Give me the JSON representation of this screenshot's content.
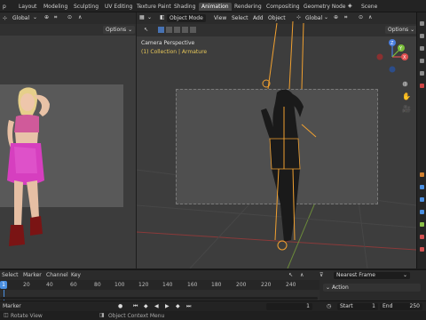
{
  "topbar": {
    "app_icon_text": "p",
    "tabs": [
      "Layout",
      "Modeling",
      "Sculpting",
      "UV Editing",
      "Texture Paint",
      "Shading",
      "Animation",
      "Rendering",
      "Compositing",
      "Geometry Node"
    ],
    "active_tab": "Animation",
    "scene_label": "Scene"
  },
  "left_viewport": {
    "orientation": "Global",
    "options_label": "Options"
  },
  "main_viewport": {
    "mode": "Object Mode",
    "menus": [
      "View",
      "Select",
      "Add",
      "Object"
    ],
    "orientation": "Global",
    "options_label": "Options",
    "camera_title": "Camera Perspective",
    "collection_text": "(1) Collection | Armature",
    "gizmo_axes": {
      "z": "Z",
      "y": "Y",
      "x": "X"
    }
  },
  "timeline": {
    "menus": [
      "Select",
      "Marker",
      "Channel",
      "Key"
    ],
    "snap_mode": "Nearest Frame",
    "ticks": [
      "1",
      "20",
      "40",
      "60",
      "80",
      "100",
      "120",
      "140",
      "160",
      "180",
      "200",
      "220",
      "240"
    ],
    "current_frame": "1",
    "action_label": "Action",
    "marker_label": "Marker",
    "frame_field": "1",
    "start_label": "Start",
    "start_value": "1",
    "end_label": "End",
    "end_value": "250"
  },
  "statusbar": {
    "left_hint": "Rotate View",
    "right_hint": "Object Context Menu"
  },
  "colors": {
    "accent_blue": "#4772b3",
    "armature_orange": "#f0a030",
    "playhead_blue": "#4a8fe0",
    "collection_yellow": "#e8c85a"
  }
}
